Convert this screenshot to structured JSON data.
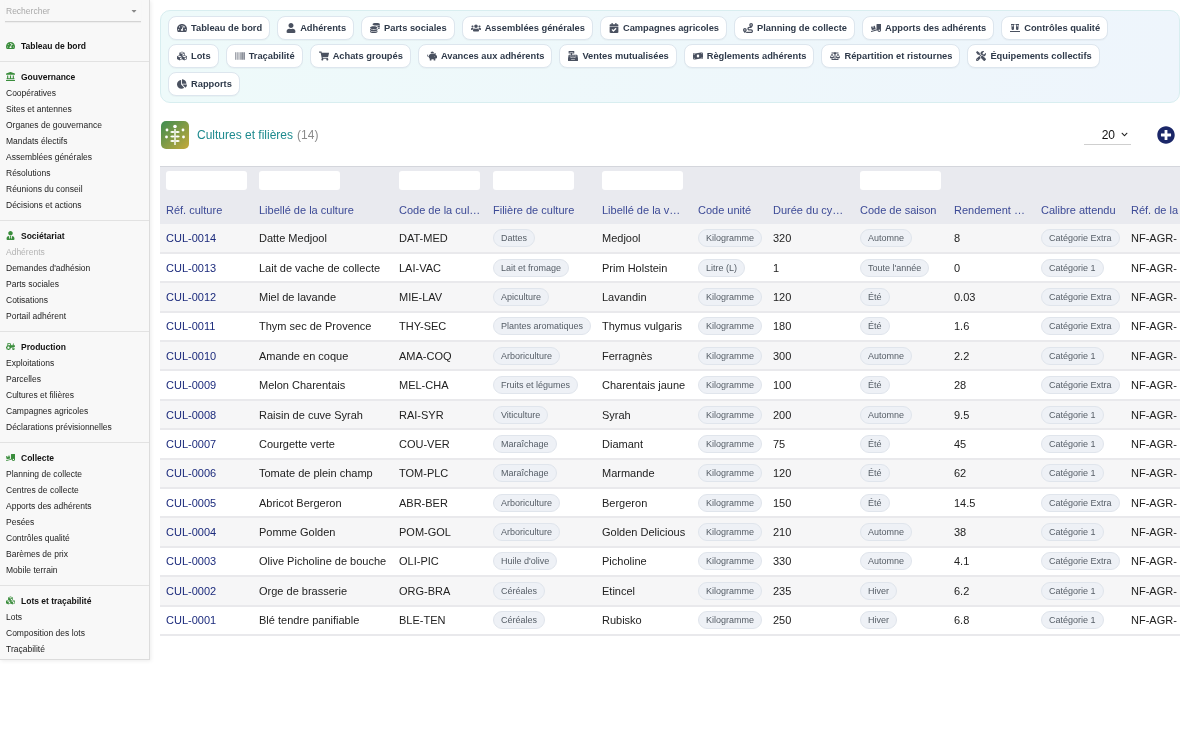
{
  "sidebar": {
    "search": {
      "placeholder": "Rechercher"
    },
    "sections": [
      {
        "title": "Tableau de bord"
      },
      {
        "title": "Gouvernance",
        "items": [
          {
            "label": "Coopératives",
            "disabled": false
          },
          {
            "label": "Sites et antennes",
            "disabled": false
          },
          {
            "label": "Organes de gouvernance",
            "disabled": false
          },
          {
            "label": "Mandats électifs",
            "disabled": false
          },
          {
            "label": "Assemblées générales",
            "disabled": false
          },
          {
            "label": "Résolutions",
            "disabled": false
          },
          {
            "label": "Réunions du conseil",
            "disabled": false
          },
          {
            "label": "Décisions et actions",
            "disabled": false
          }
        ]
      },
      {
        "title": "Sociétariat",
        "items": [
          {
            "label": "Adhérents",
            "disabled": true
          },
          {
            "label": "Demandes d'adhésion",
            "disabled": false
          },
          {
            "label": "Parts sociales",
            "disabled": false
          },
          {
            "label": "Cotisations",
            "disabled": false
          },
          {
            "label": "Portail adhérent",
            "disabled": false
          }
        ]
      },
      {
        "title": "Production",
        "items": [
          {
            "label": "Exploitations",
            "disabled": false
          },
          {
            "label": "Parcelles",
            "disabled": false
          },
          {
            "label": "Cultures et filières",
            "disabled": false
          },
          {
            "label": "Campagnes agricoles",
            "disabled": false
          },
          {
            "label": "Déclarations prévisionnelles",
            "disabled": false
          }
        ]
      },
      {
        "title": "Collecte",
        "items": [
          {
            "label": "Planning de collecte",
            "disabled": false
          },
          {
            "label": "Centres de collecte",
            "disabled": false
          },
          {
            "label": "Apports des adhérents",
            "disabled": false
          },
          {
            "label": "Pesées",
            "disabled": false
          },
          {
            "label": "Contrôles qualité",
            "disabled": false
          },
          {
            "label": "Barèmes de prix",
            "disabled": false
          },
          {
            "label": "Mobile terrain",
            "disabled": false
          }
        ]
      },
      {
        "title": "Lots et traçabilité",
        "items": [
          {
            "label": "Lots",
            "disabled": false
          },
          {
            "label": "Composition des lots",
            "disabled": false
          },
          {
            "label": "Traçabilité",
            "disabled": false
          }
        ]
      }
    ]
  },
  "nav": {
    "rows": [
      [
        "Tableau de bord",
        "Adhérents",
        "Parts sociales",
        "Assemblées générales",
        "Campagnes agricoles",
        "Planning de collecte",
        "Apports des adhérents",
        "Contrôles qualité"
      ],
      [
        "Lots",
        "Traçabilité",
        "Achats groupés",
        "Avances aux adhérents",
        "Ventes mutualisées",
        "Règlements adhérents",
        "Répartition et ristournes",
        "Équipements collectifs"
      ],
      [
        "Rapports"
      ]
    ]
  },
  "header": {
    "title": "Cultures et filières",
    "count": "(14)",
    "page_size": "20"
  },
  "table": {
    "columns": [
      {
        "label": "Réf. culture",
        "kind": "link",
        "filter": true
      },
      {
        "label": "Libellé de la culture",
        "kind": "text",
        "filter": true
      },
      {
        "label": "Code de la cul…",
        "kind": "text",
        "filter": true
      },
      {
        "label": "Filière de culture",
        "kind": "chip",
        "filter": true
      },
      {
        "label": "Libellé de la v…",
        "kind": "text",
        "filter": true
      },
      {
        "label": "Code unité",
        "kind": "chip",
        "filter": false
      },
      {
        "label": "Durée du cy…",
        "kind": "text",
        "filter": false
      },
      {
        "label": "Code de saison",
        "kind": "chip",
        "filter": true
      },
      {
        "label": "Rendement …",
        "kind": "text",
        "filter": false
      },
      {
        "label": "Calibre attendu",
        "kind": "chip",
        "filter": false
      },
      {
        "label": "Réf. de la",
        "kind": "text",
        "filter": false
      }
    ],
    "rows": [
      [
        "CUL-0014",
        "Datte Medjool",
        "DAT-MED",
        "Dattes",
        "Medjool",
        "Kilogramme",
        "320",
        "Automne",
        "8",
        "Catégorie Extra",
        "NF-AGR-"
      ],
      [
        "CUL-0013",
        "Lait de vache de collecte",
        "LAI-VAC",
        "Lait et fromage",
        "Prim Holstein",
        "Litre (L)",
        "1",
        "Toute l'année",
        "0",
        "Catégorie 1",
        "NF-AGR-"
      ],
      [
        "CUL-0012",
        "Miel de lavande",
        "MIE-LAV",
        "Apiculture",
        "Lavandin",
        "Kilogramme",
        "120",
        "Été",
        "0.03",
        "Catégorie Extra",
        "NF-AGR-"
      ],
      [
        "CUL-0011",
        "Thym sec de Provence",
        "THY-SEC",
        "Plantes aromatiques",
        "Thymus vulgaris",
        "Kilogramme",
        "180",
        "Été",
        "1.6",
        "Catégorie Extra",
        "NF-AGR-"
      ],
      [
        "CUL-0010",
        "Amande en coque",
        "AMA-COQ",
        "Arboriculture",
        "Ferragnès",
        "Kilogramme",
        "300",
        "Automne",
        "2.2",
        "Catégorie 1",
        "NF-AGR-"
      ],
      [
        "CUL-0009",
        "Melon Charentais",
        "MEL-CHA",
        "Fruits et légumes",
        "Charentais jaune",
        "Kilogramme",
        "100",
        "Été",
        "28",
        "Catégorie Extra",
        "NF-AGR-"
      ],
      [
        "CUL-0008",
        "Raisin de cuve Syrah",
        "RAI-SYR",
        "Viticulture",
        "Syrah",
        "Kilogramme",
        "200",
        "Automne",
        "9.5",
        "Catégorie 1",
        "NF-AGR-"
      ],
      [
        "CUL-0007",
        "Courgette verte",
        "COU-VER",
        "Maraîchage",
        "Diamant",
        "Kilogramme",
        "75",
        "Été",
        "45",
        "Catégorie 1",
        "NF-AGR-"
      ],
      [
        "CUL-0006",
        "Tomate de plein champ",
        "TOM-PLC",
        "Maraîchage",
        "Marmande",
        "Kilogramme",
        "120",
        "Été",
        "62",
        "Catégorie 1",
        "NF-AGR-"
      ],
      [
        "CUL-0005",
        "Abricot Bergeron",
        "ABR-BER",
        "Arboriculture",
        "Bergeron",
        "Kilogramme",
        "150",
        "Été",
        "14.5",
        "Catégorie Extra",
        "NF-AGR-"
      ],
      [
        "CUL-0004",
        "Pomme Golden",
        "POM-GOL",
        "Arboriculture",
        "Golden Delicious",
        "Kilogramme",
        "210",
        "Automne",
        "38",
        "Catégorie 1",
        "NF-AGR-"
      ],
      [
        "CUL-0003",
        "Olive Picholine de bouche",
        "OLI-PIC",
        "Huile d'olive",
        "Picholine",
        "Kilogramme",
        "330",
        "Automne",
        "4.1",
        "Catégorie Extra",
        "NF-AGR-"
      ],
      [
        "CUL-0002",
        "Orge de brasserie",
        "ORG-BRA",
        "Céréales",
        "Etincel",
        "Kilogramme",
        "235",
        "Hiver",
        "6.2",
        "Catégorie 1",
        "NF-AGR-"
      ],
      [
        "CUL-0001",
        "Blé tendre panifiable",
        "BLE-TEN",
        "Céréales",
        "Rubisko",
        "Kilogramme",
        "250",
        "Hiver",
        "6.8",
        "Catégorie 1",
        "NF-AGR-"
      ]
    ]
  }
}
